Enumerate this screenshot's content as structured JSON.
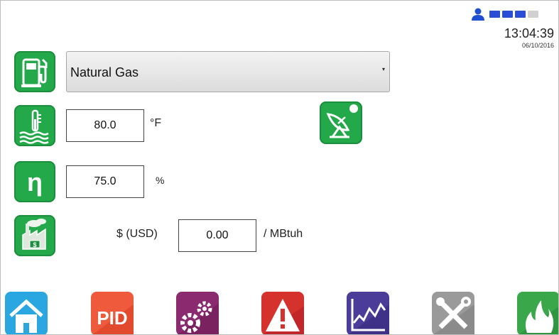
{
  "status": {
    "time": "13:04:39",
    "date": "06/10/2016",
    "user_color": "#1d4fd0",
    "signal_colors": [
      "#2a4fd6",
      "#2a4fd6",
      "#2a4fd6",
      "#d0d0d0"
    ]
  },
  "fuel": {
    "icon": "fuel-pump-icon",
    "selected": "Natural Gas",
    "dropdown_arrow": "▾"
  },
  "temperature": {
    "icon": "thermometer-water-icon",
    "value": "80.0",
    "unit": "°F"
  },
  "efficiency": {
    "icon": "eta-icon",
    "symbol": "η",
    "value": "75.0",
    "unit": "%"
  },
  "cost": {
    "icon": "factory-cost-icon",
    "currency_label": "$ (USD)",
    "value": "0.00",
    "unit": "/ MBtuh"
  },
  "remote": {
    "icon": "satellite-dish-icon"
  },
  "nav": [
    {
      "icon": "home-icon",
      "color": "#2aa6e0"
    },
    {
      "icon": "pid-icon",
      "label": "PID",
      "color": "#f05a3c"
    },
    {
      "icon": "settings-gears-icon",
      "color": "#8b2a6e"
    },
    {
      "icon": "alarm-warning-icon",
      "color": "#d6322d"
    },
    {
      "icon": "trend-chart-icon",
      "color": "#4b3c9a"
    },
    {
      "icon": "tools-icon",
      "color": "#9a9a9a"
    },
    {
      "icon": "flame-icon",
      "color": "#3aa84a"
    }
  ]
}
